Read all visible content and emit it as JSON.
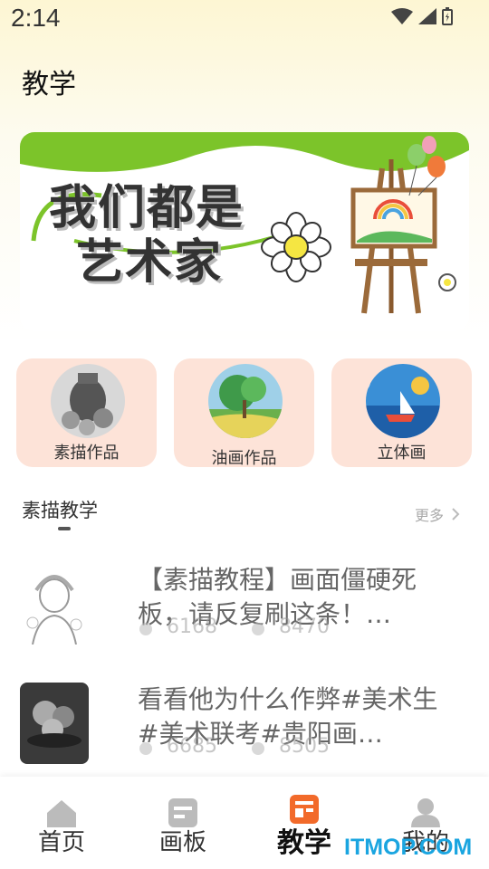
{
  "status_bar": {
    "time": "2:14"
  },
  "page_title": "教学",
  "banner": {
    "line1": "我们都是",
    "line2": "艺术家"
  },
  "categories": [
    {
      "label": "素描作品"
    },
    {
      "label": "油画作品"
    },
    {
      "label": "立体画"
    }
  ],
  "section": {
    "title": "素描教学",
    "more": "更多"
  },
  "items": [
    {
      "title": "【素描教程】画面僵硬死板，请反复刷这条！…",
      "likes": "6168",
      "views": "8470"
    },
    {
      "title": "看看他为什么作弊#美术生#美术联考#贵阳画…",
      "likes": "6685",
      "views": "8505"
    }
  ],
  "tabs": [
    {
      "label": "首页",
      "icon": "home-icon"
    },
    {
      "label": "画板",
      "icon": "board-icon"
    },
    {
      "label": "教学",
      "icon": "teach-icon"
    },
    {
      "label": "我的",
      "icon": "user-icon"
    }
  ],
  "watermark": "ITMOP.COM",
  "colors": {
    "accent": "#f26a2a",
    "card_bg": "#fde3d8",
    "banner_green": "#7cc42a",
    "watermark": "#1aa5e0"
  }
}
